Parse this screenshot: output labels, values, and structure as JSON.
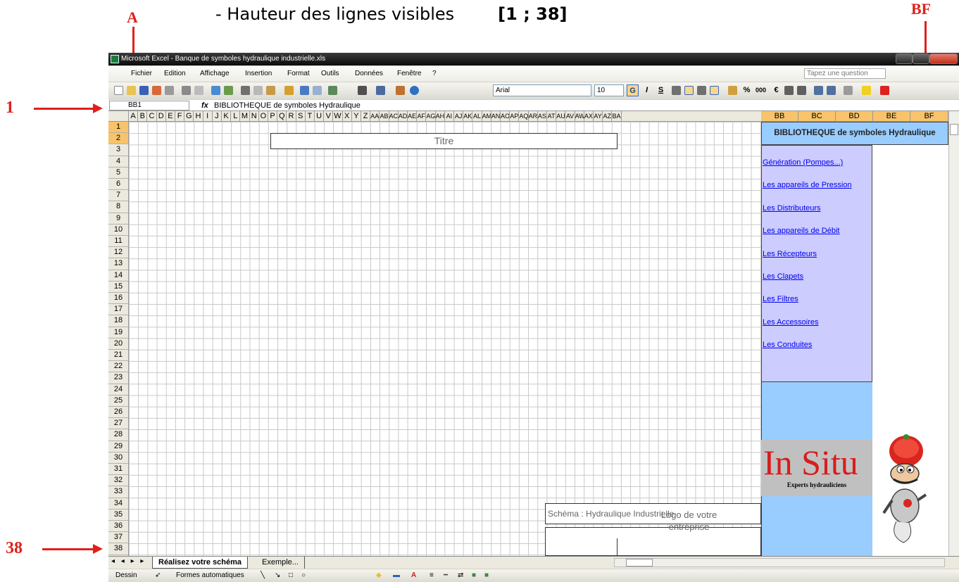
{
  "annotations": {
    "label_a": "A",
    "label_bf": "BF",
    "label_row1": "1",
    "label_row38": "38",
    "heading_text": "- Hauteur des lignes visibles",
    "heading_range": "[1 ; 38]"
  },
  "window": {
    "title": "Microsoft Excel - Banque de symboles hydraulique industrielle.xls"
  },
  "menu": {
    "items": [
      "Fichier",
      "Edition",
      "Affichage",
      "Insertion",
      "Format",
      "Outils",
      "Données",
      "Fenêtre",
      "?"
    ],
    "question_placeholder": "Tapez une question"
  },
  "format_toolbar": {
    "font_name": "Arial",
    "font_size": "10",
    "bold": "G",
    "italic": "I",
    "underline": "S",
    "percent": "%",
    "thousands": "000",
    "euro": "€"
  },
  "formula_bar": {
    "name_box": "BB1",
    "fx": "fx",
    "content": "BIBLIOTHEQUE de symboles Hydraulique"
  },
  "columns": {
    "narrow": [
      "A",
      "B",
      "C",
      "D",
      "E",
      "F",
      "G",
      "H",
      "I",
      "J",
      "K",
      "L",
      "M",
      "N",
      "O",
      "P",
      "Q",
      "R",
      "S",
      "T",
      "U",
      "V",
      "W",
      "X",
      "Y",
      "Z",
      "AA",
      "AB",
      "AC",
      "AD",
      "AE",
      "AF",
      "AG",
      "AH",
      "AI",
      "AJ",
      "AK",
      "AL",
      "AM",
      "AN",
      "AO",
      "AP",
      "AQ",
      "AR",
      "AS",
      "AT",
      "AU",
      "AV",
      "AW",
      "AX",
      "AY",
      "AZ",
      "BA"
    ],
    "wide": [
      "BB",
      "BC",
      "BD",
      "BE",
      "BF"
    ]
  },
  "rows": [
    "1",
    "2",
    "3",
    "4",
    "5",
    "6",
    "7",
    "8",
    "9",
    "10",
    "11",
    "12",
    "13",
    "14",
    "15",
    "16",
    "17",
    "18",
    "19",
    "20",
    "21",
    "22",
    "23",
    "24",
    "25",
    "26",
    "27",
    "28",
    "29",
    "30",
    "31",
    "32",
    "33",
    "34",
    "35",
    "36",
    "37",
    "38"
  ],
  "sheet": {
    "titre": "Titre",
    "schema_label": "Schéma : Hydraulique Industrielle",
    "logo_placeholder_line1": "Logo de votre",
    "logo_placeholder_line2": "entreprise"
  },
  "library": {
    "header": "BIBLIOTHEQUE de symboles Hydraulique",
    "links": [
      "Génération (Pompes...)",
      "Les appareils de Pression",
      "Les Distributeurs",
      "Les appareils de Débit",
      "Les Récepteurs",
      "Les Clapets",
      "Les Filtres",
      "Les Accessoires",
      "Les Conduites"
    ],
    "brand": "In Situ",
    "brand_tagline": "Experts hydrauliciens"
  },
  "tabs": {
    "active": "Réalisez votre schéma",
    "other": "Exemple..."
  },
  "draw_toolbar": {
    "dessin": "Dessin",
    "formes": "Formes automatiques"
  },
  "colors": {
    "annotation_red": "#e0201c",
    "selected_header": "#f8c36a",
    "links_panel": "#ccccff",
    "blue_panel": "#99ccff",
    "brand_red": "#d81c1c"
  }
}
